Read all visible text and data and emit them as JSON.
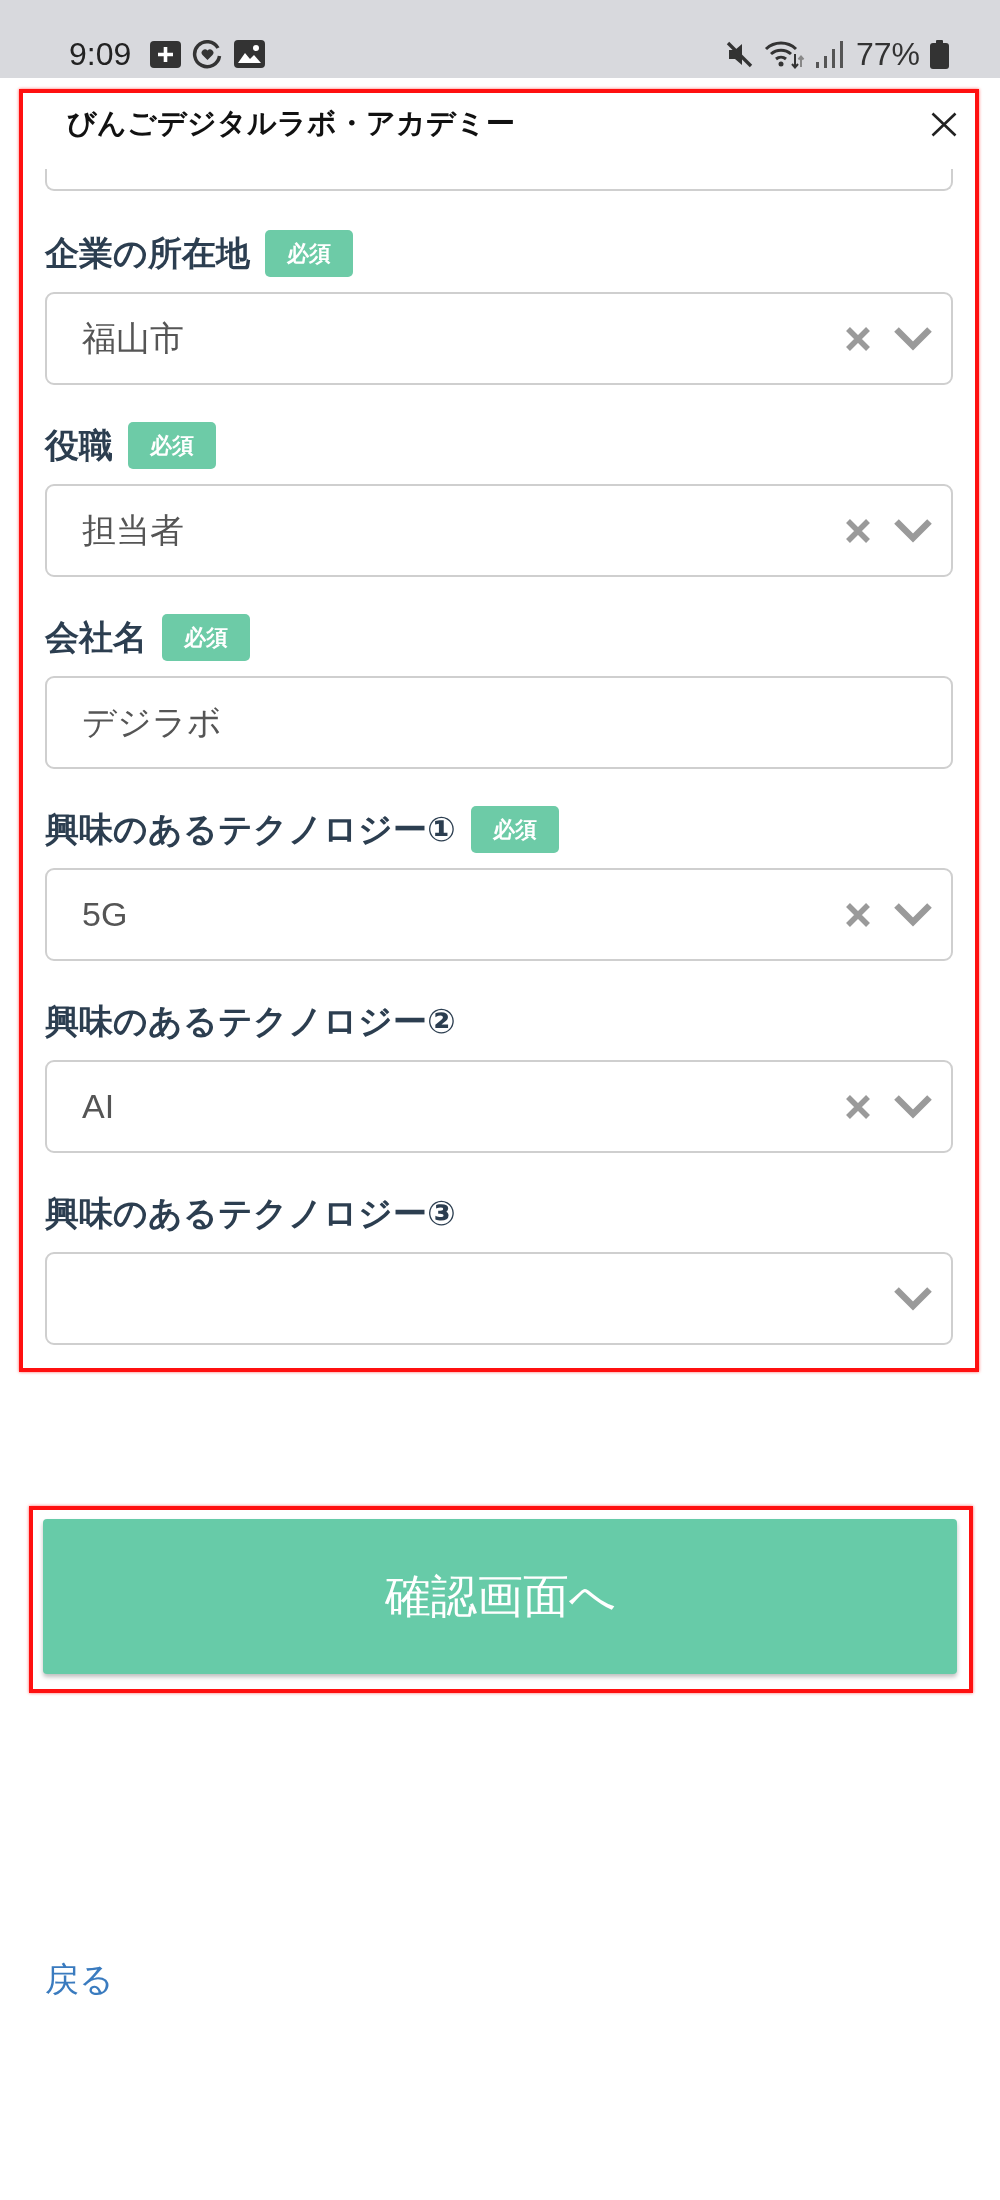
{
  "status_bar": {
    "time": "9:09",
    "battery_percent": "77%"
  },
  "form": {
    "title": "びんごデジタルラボ・アカデミー",
    "highlighted": true,
    "fields": [
      {
        "cut_off": true
      },
      {
        "label": "企業の所在地",
        "badge": "必須",
        "kind": "select",
        "value": "福山市"
      },
      {
        "label": "役職",
        "badge": "必須",
        "kind": "select",
        "value": "担当者"
      },
      {
        "label": "会社名",
        "badge": "必須",
        "kind": "text",
        "value": "デジラボ"
      },
      {
        "label": "興味のあるテクノロジー①",
        "badge": "必須",
        "kind": "select",
        "value": "5G"
      },
      {
        "label": "興味のあるテクノロジー②",
        "kind": "select",
        "value": "AI"
      },
      {
        "label": "興味のあるテクノロジー③",
        "kind": "select"
      }
    ]
  },
  "confirm_button": {
    "label": "確認画面へ",
    "highlighted": true
  },
  "back_link": "戻る"
}
